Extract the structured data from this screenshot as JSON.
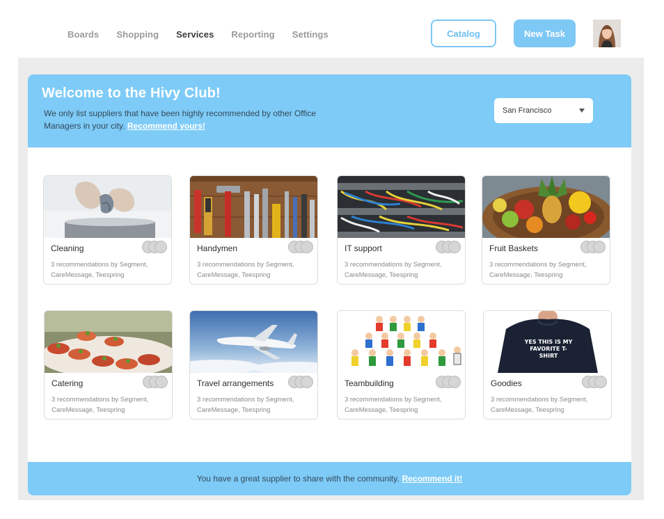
{
  "nav": {
    "items": [
      {
        "label": "Boards",
        "active": false
      },
      {
        "label": "Shopping",
        "active": false
      },
      {
        "label": "Services",
        "active": true
      },
      {
        "label": "Reporting",
        "active": false
      },
      {
        "label": "Settings",
        "active": false
      }
    ],
    "catalog_label": "Catalog",
    "new_task_label": "New Task"
  },
  "hero": {
    "title": "Welcome to the Hivy Club!",
    "text": "We only list suppliers that have been highly recommended by other Office Managers in your city.",
    "link": "Recommend yours!",
    "city": "San Francisco"
  },
  "cards": [
    {
      "name": "Cleaning",
      "rec": "3 recommendations by Segment, CareMessage, Teespring"
    },
    {
      "name": "Handymen",
      "rec": "3 recommendations by Segment, CareMessage, Teespring"
    },
    {
      "name": "IT support",
      "rec": "3 recommendations by Segment, CareMessage, Teespring"
    },
    {
      "name": "Fruit Baskets",
      "rec": "3 recommendations by Segment, CareMessage, Teespring"
    },
    {
      "name": "Catering",
      "rec": "3 recommendations by Segment, CareMessage, Teespring"
    },
    {
      "name": "Travel arrangements",
      "rec": "3 recommendations by Segment, CareMessage, Teespring"
    },
    {
      "name": "Teambuilding",
      "rec": "3 recommendations by Segment, CareMessage, Teespring"
    },
    {
      "name": "Goodies",
      "rec": "3 recommendations by Segment, CareMessage, Teespring"
    }
  ],
  "goodies_shirt_text": "YES THIS IS MY FAVORITE T-SHIRT",
  "footer": {
    "text": "You have a great supplier to share with the community.",
    "link": "Recommend it!"
  },
  "colors": {
    "accent": "#7ecbf7",
    "nav_active": "#3c3c3c",
    "nav_inactive": "#9a9a9a"
  }
}
